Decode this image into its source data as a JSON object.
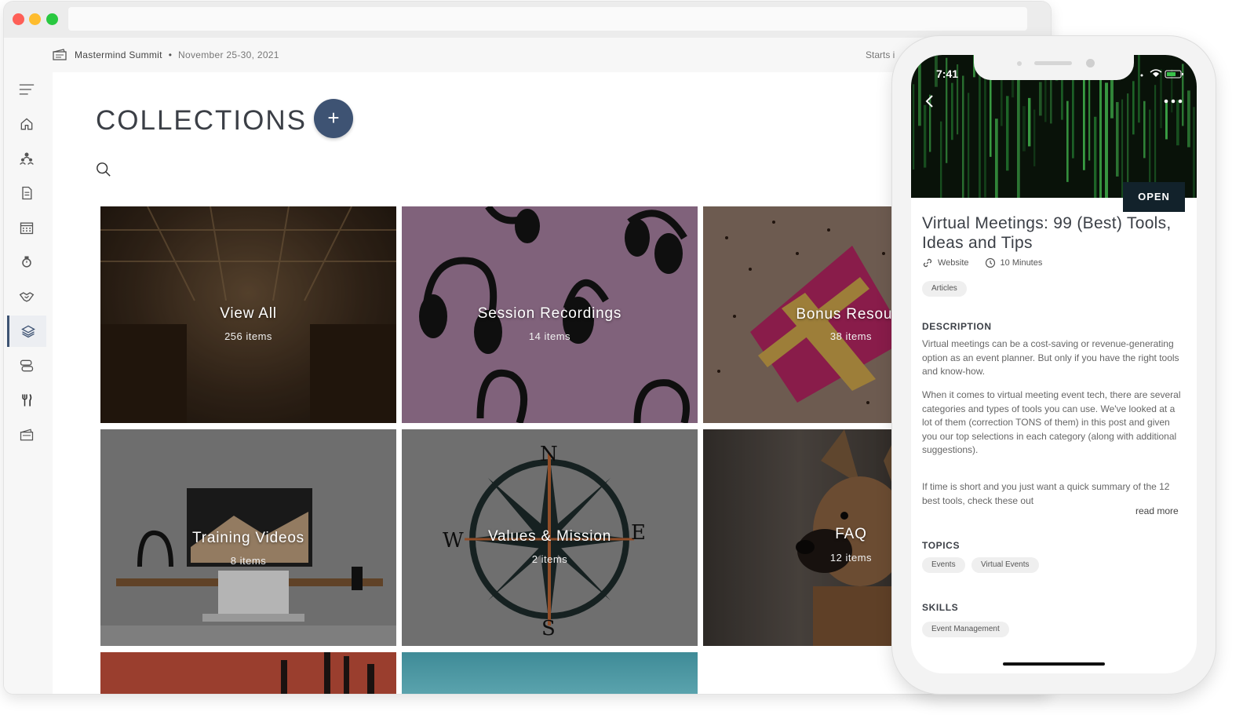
{
  "browser": {
    "traffic_lights": [
      "close",
      "minimize",
      "zoom"
    ]
  },
  "event": {
    "name": "Mastermind Summit",
    "separator": "•",
    "date": "November 25-30, 2021",
    "starts_label": "Starts i"
  },
  "sidebar": {
    "items": [
      {
        "name": "menu",
        "icon": "menu-icon",
        "active": false
      },
      {
        "name": "home",
        "icon": "home-icon",
        "active": false
      },
      {
        "name": "network",
        "icon": "people-icon",
        "active": false
      },
      {
        "name": "documents",
        "icon": "document-icon",
        "active": false
      },
      {
        "name": "calendar",
        "icon": "calendar-icon",
        "active": false
      },
      {
        "name": "watch",
        "icon": "watch-icon",
        "active": false
      },
      {
        "name": "sponsors",
        "icon": "handshake-icon",
        "active": false
      },
      {
        "name": "collections",
        "icon": "layers-icon",
        "active": true
      },
      {
        "name": "agenda",
        "icon": "stack-icon",
        "active": false
      },
      {
        "name": "dining",
        "icon": "fork-knife-icon",
        "active": false
      },
      {
        "name": "tickets",
        "icon": "ticket-icon",
        "active": false
      }
    ]
  },
  "main": {
    "title": "COLLECTIONS",
    "add_label": "+",
    "collections": [
      {
        "title": "View All",
        "count": "256 items"
      },
      {
        "title": "Session Recordings",
        "count": "14 items"
      },
      {
        "title": "Bonus Resourc",
        "count": "38 items"
      },
      {
        "title": "Training Videos",
        "count": "8 items"
      },
      {
        "title": "Values & Mission",
        "count": "2 items"
      },
      {
        "title": "FAQ",
        "count": "12 items"
      }
    ]
  },
  "phone": {
    "time": "7:41",
    "open_label": "OPEN",
    "article": {
      "title": "Virtual Meetings: 99 (Best) Tools, Ideas and Tips",
      "type": "Website",
      "duration": "10 Minutes",
      "tag": "Articles",
      "description_heading": "DESCRIPTION",
      "paragraphs": [
        "Virtual meetings can be a cost-saving or revenue-generating option as an event planner. But only if you have the right tools and know-how.",
        "When it comes to virtual meeting event tech, there are several categories and types of tools you can use. We've looked at a lot of them (correction TONS of them) in this post and given you our top selections in each category (along with additional suggestions).",
        "If time is short and you just want a quick summary of the 12 best tools, check these out"
      ],
      "read_more": "read more",
      "topics_heading": "TOPICS",
      "topics": [
        "Events",
        "Virtual Events"
      ],
      "skills_heading": "SKILLS",
      "skills": [
        "Event Management"
      ]
    }
  },
  "colors": {
    "accent": "#3e5373",
    "open_button": "#12222b"
  }
}
